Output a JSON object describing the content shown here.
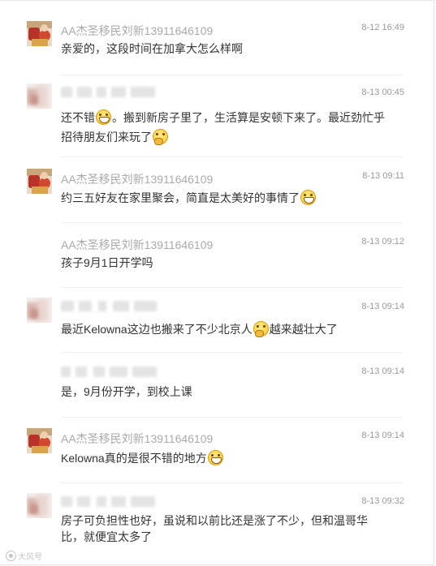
{
  "comments": [
    {
      "author": "AA杰圣移民刘新13911646109",
      "time": "8-12 16:49",
      "text": "亲爱的，这段时间在加拿大怎么样啊"
    },
    {
      "author": "",
      "time": "8-13 00:45",
      "text_a": "还不错",
      "text_b": "。搬到新房子里了，生活算是安顿下来了。最近劲忙乎招待朋友们来玩了",
      "text_c": ""
    },
    {
      "author": "AA杰圣移民刘新13911646109",
      "time": "8-13 09:11",
      "text": "约三五好友在家里聚会，简直是太美好的事情了"
    },
    {
      "author": "AA杰圣移民刘新13911646109",
      "time": "8-13 09:12",
      "text": "孩子9月1日开学吗"
    },
    {
      "author": "",
      "time": "8-13 09:14",
      "text_a": "最近Kelowna这边也搬来了不少北京人",
      "text_b": "越来越壮大了"
    },
    {
      "author": "",
      "time": "8-13 09:14",
      "text": "是，9月份开学，到校上课"
    },
    {
      "author": "AA杰圣移民刘新13911646109",
      "time": "8-13 09:14",
      "text": "Kelowna真的是很不错的地方"
    },
    {
      "author": "",
      "time": "8-13 09:32",
      "text": "房子可负担性也好，虽说和以前比还是涨了不少，但和温哥华比，就便宜太多了"
    }
  ],
  "icons": {
    "grin": "grin-emoji-icon",
    "think": "thinking-emoji-icon"
  },
  "watermark": "大风号"
}
